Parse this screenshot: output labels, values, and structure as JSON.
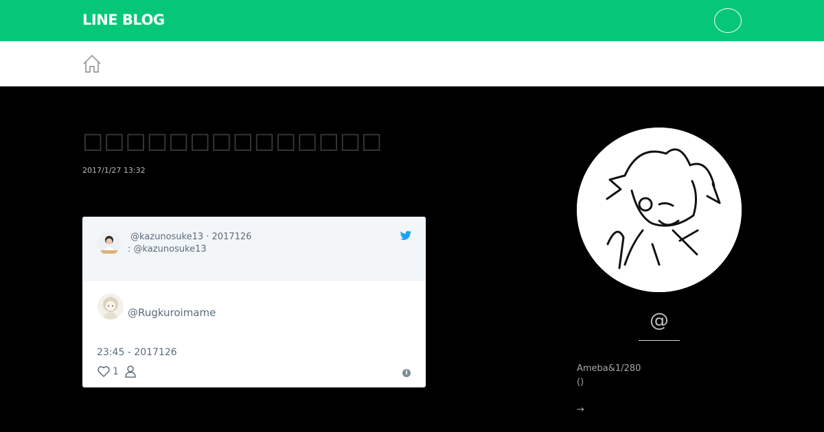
{
  "header": {
    "logo_text": "LINE BLOG",
    "brand_color": "#06c779",
    "menu_icon": "menu-circle-icon"
  },
  "subnav": {
    "home_icon": "home-icon"
  },
  "article": {
    "title": "□□□□□□□□□□□□□□□□□□□□□□□□□□□□□□□□□□□",
    "date": "2017/1/27 13:32"
  },
  "tweet": {
    "author_line": "@kazunosuke13 · 2017126",
    "reply_line": ": @kazunosuke13",
    "user": "@Rugkuroimame",
    "time": "23:45 - 2017126",
    "likes": "1",
    "info_glyph": "i",
    "icons": [
      "twitter-bird-icon",
      "heart-icon",
      "person-icon",
      "info-icon"
    ]
  },
  "sidebar": {
    "at_symbol": "@",
    "bio_line1": "Ameba&1/280",
    "bio_line2": "()",
    "more_arrow": "→"
  }
}
